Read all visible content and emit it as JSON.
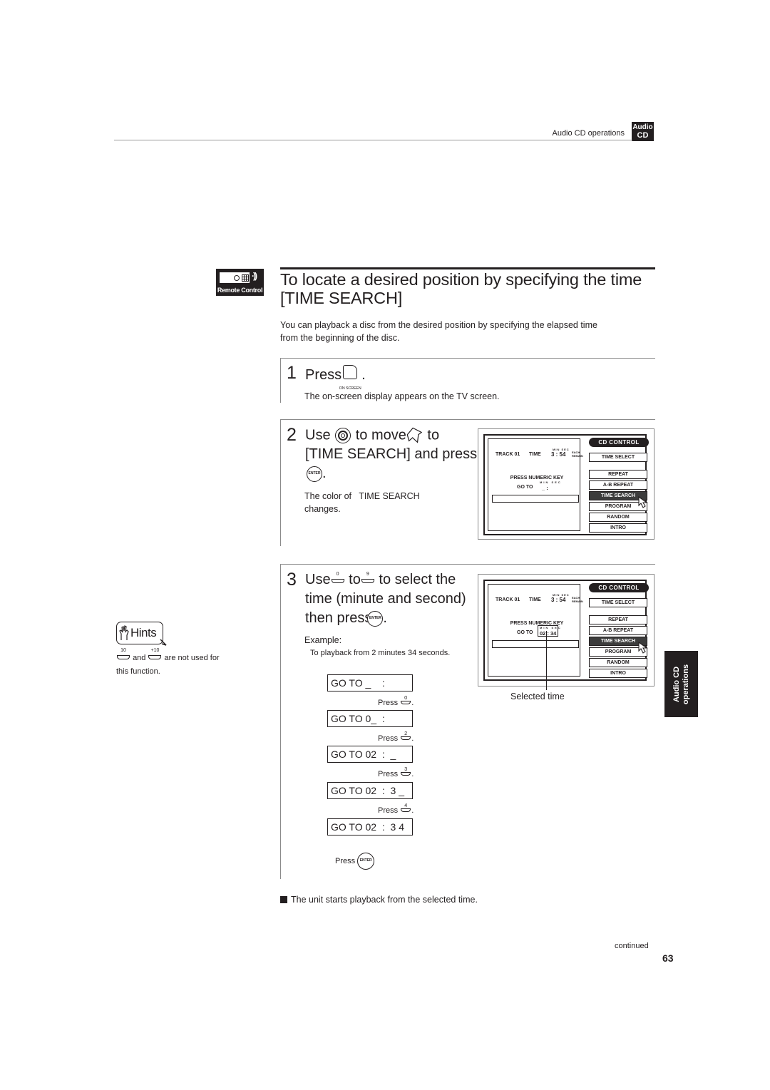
{
  "header": {
    "section": "Audio CD operations",
    "badge_line1": "Audio",
    "badge_line2": "CD"
  },
  "remote_icon": {
    "label": "Remote Control",
    "waves": "·))"
  },
  "title": {
    "line1": "To locate a desired position by specifying the time",
    "line2": "[TIME SEARCH]"
  },
  "intro": {
    "line1": "You can playback a disc from the desired position by specifying the elapsed time",
    "line2": "from the beginning of the disc."
  },
  "step1": {
    "number": "1",
    "press": "Press",
    "button_caption": "ON SCREEN",
    "period": ".",
    "note": "The on-screen display appears on the TV screen."
  },
  "step2": {
    "number": "2",
    "use": "Use",
    "to_move": "to move",
    "to": "to",
    "line2": "[TIME SEARCH] and press",
    "enter_label": "ENTER",
    "period": ".",
    "note_line1": "The color of   TIME SEARCH",
    "note_line2": "changes."
  },
  "step3": {
    "number": "3",
    "use": "Use",
    "key_from": "0",
    "to": "to",
    "key_to": "9",
    "to_select": "to select the",
    "line2": "time (minute and second)",
    "line3": "then press",
    "enter_label": "ENTER",
    "period": ".",
    "example_label": "Example:",
    "example_text": "To playback from 2 minutes 34 seconds.",
    "sequence": [
      {
        "display": "GO TO _    :",
        "press": "Press",
        "key": "0"
      },
      {
        "display": "GO TO 0_  :",
        "press": "Press",
        "key": "2"
      },
      {
        "display": "GO TO 02  :  _",
        "press": "Press",
        "key": "3"
      },
      {
        "display": "GO TO 02  :  3 _",
        "press": "Press",
        "key": "4"
      },
      {
        "display": "GO TO 02  :  3 4"
      }
    ],
    "final_press": "Press",
    "final_enter": "ENTER",
    "selected_time_label": "Selected time"
  },
  "osd_common": {
    "tab": "CD CONTROL",
    "track": "TRACK 01",
    "time_label": "TIME",
    "min_sec": "MIN  SEC",
    "time_value": "3 : 54",
    "each": "EACH",
    "remain": "REMAIN",
    "press_numeric": "PRESS NUMERIC KEY",
    "goto_label": "GO TO",
    "menu": [
      "TIME SELECT",
      "REPEAT",
      "A-B REPEAT",
      "TIME SEARCH",
      "PROGRAM",
      "RANDOM",
      "INTRO"
    ],
    "selected_item": "TIME SEARCH"
  },
  "osd1": {
    "goto_value": "_ :"
  },
  "osd2": {
    "goto_value": "02 : 34"
  },
  "hints": {
    "badge": "Hints",
    "key1": "10",
    "and": "and",
    "key2": "+10",
    "text1": "are not used for",
    "text2": "this function."
  },
  "side_tab": {
    "line1": "Audio CD",
    "line2": "operations"
  },
  "result": "The unit starts playback from the selected time.",
  "footer": {
    "continued": "continued",
    "page_number": "63"
  }
}
